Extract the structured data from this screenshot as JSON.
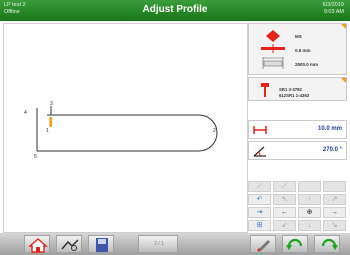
{
  "titlebar": {
    "left_line1": "LP test 2",
    "left_line2": "Offline",
    "title": "Adjust Profile",
    "date": "6/3/2019",
    "time": "9:03 AM"
  },
  "canvas": {
    "point_labels": [
      "4",
      "3",
      "1",
      "2",
      "5"
    ]
  },
  "material": {
    "name": "MS",
    "thickness": "0.6 mm",
    "length": "2500.0 mm"
  },
  "tool": {
    "line1": "SR1 3-3782",
    "line2": "612SR1 1-4363"
  },
  "values": {
    "length": "10.0 mm",
    "angle": "270.0 °"
  },
  "footer": {
    "page_indicator": "2 / 1"
  },
  "colors": {
    "title_green": "#1f7f1f",
    "accent_red": "#e32219",
    "value_blue": "#1f3b98",
    "corner_orange": "#f19a1b"
  }
}
